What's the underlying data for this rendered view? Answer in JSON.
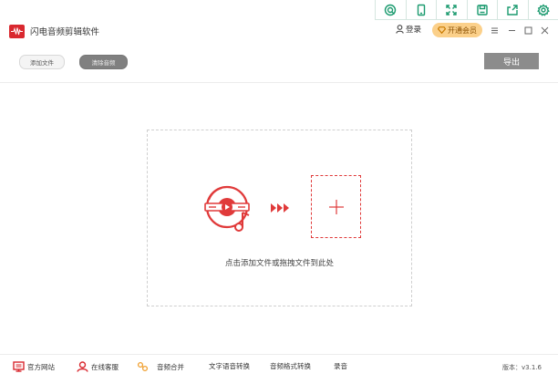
{
  "app": {
    "title": "闪电音频剪辑软件"
  },
  "header": {
    "login_label": "登录",
    "vip_label": "开通会员"
  },
  "toolbar": {
    "add_file_label": "添加文件",
    "clear_audio_label": "清除音频",
    "export_label": "导出"
  },
  "dropzone": {
    "hint": "点击添加文件或拖拽文件到此处"
  },
  "footer": {
    "items": [
      {
        "label": "官方网站",
        "icon": "monitor-icon"
      },
      {
        "label": "在线客服",
        "icon": "user-icon"
      },
      {
        "label": "音频合并",
        "icon": "merge-icon"
      },
      {
        "label": "文字语音转换",
        "icon": ""
      },
      {
        "label": "音频格式转换",
        "icon": ""
      },
      {
        "label": "录音",
        "icon": ""
      }
    ],
    "version": "版本：v3.1.6"
  },
  "colors": {
    "brand_red": "#d9282f",
    "accent_green": "#1a9a6e",
    "vip_gold": "#fbd08a",
    "button_gray": "#8c8c8c"
  }
}
